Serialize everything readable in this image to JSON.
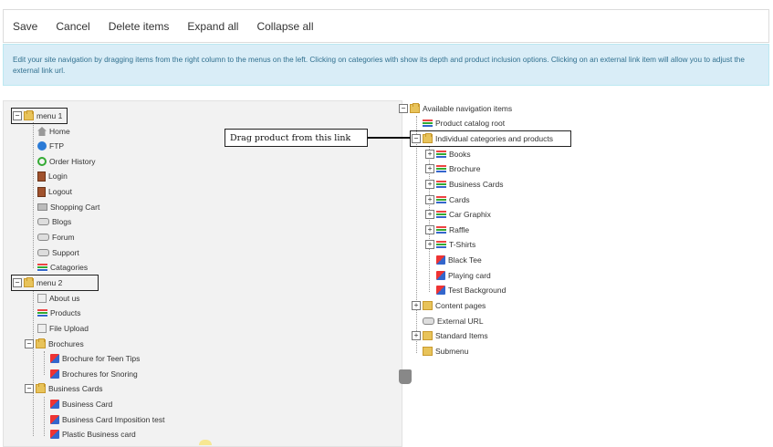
{
  "toolbar": {
    "save": "Save",
    "cancel": "Cancel",
    "delete": "Delete items",
    "expand": "Expand all",
    "collapse": "Collapse all"
  },
  "info": "Edit your site navigation by dragging items from the right column to the menus on the left. Clicking on categories with show its depth and product inclusion options. Clicking on an external link item will allow you to adjust the external link url.",
  "left_tree": {
    "menu1": {
      "label": "menu 1",
      "items": [
        "Home",
        "FTP",
        "Order History",
        "Login",
        "Logout",
        "Shopping Cart",
        "Blogs",
        "Forum",
        "Support",
        "Catagories"
      ]
    },
    "menu2": {
      "label": "menu 2",
      "items": [
        "About us",
        "Products",
        "File Upload"
      ],
      "brochures": {
        "label": "Brochures",
        "items": [
          "Brochure for Teen Tips",
          "Brochures for Snoring"
        ]
      },
      "business_cards": {
        "label": "Business Cards",
        "items": [
          "Business Card",
          "Business Card Imposition test",
          "Plastic Business card"
        ]
      }
    }
  },
  "right_tree": {
    "root": "Available navigation items",
    "product_catalog_root": "Product catalog root",
    "individual": "Individual categories and products",
    "categories": [
      "Books",
      "Brochure",
      "Business Cards",
      "Cards",
      "Car Graphix",
      "Raffle",
      "T-Shirts"
    ],
    "products": [
      "Black Tee",
      "Playing card",
      "Test Background"
    ],
    "content_pages": "Content pages",
    "external_url": "External URL",
    "standard_items": "Standard Items",
    "submenu": "Submenu"
  },
  "callout": "Drag product from this link"
}
